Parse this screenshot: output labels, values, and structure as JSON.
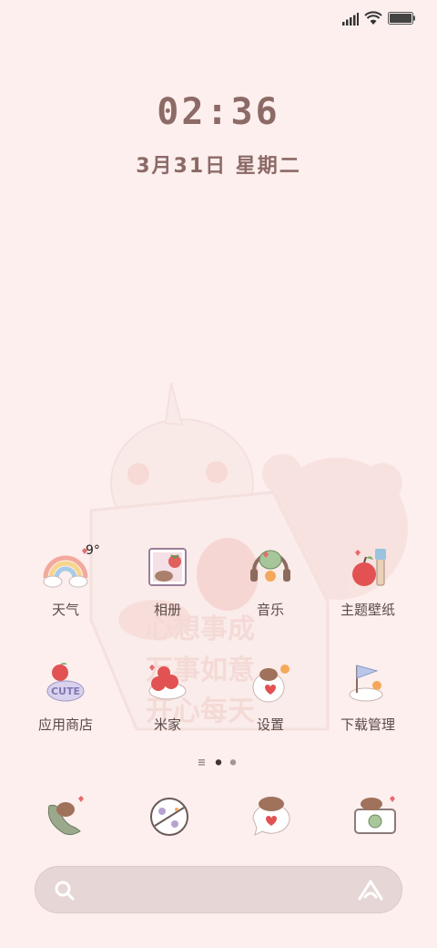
{
  "status_bar": {
    "signal_icon": "cellular-signal-icon",
    "wifi_icon": "wifi-icon",
    "battery_icon": "battery-icon"
  },
  "lock": {
    "time": "02:36",
    "date": "3月31日 星期二"
  },
  "weather_widget": {
    "temperature": "9°"
  },
  "apps": [
    {
      "label": "天气",
      "icon": "weather-rainbow-icon"
    },
    {
      "label": "相册",
      "icon": "gallery-icon"
    },
    {
      "label": "音乐",
      "icon": "music-icon"
    },
    {
      "label": "主题壁纸",
      "icon": "themes-icon"
    },
    {
      "label": "应用商店",
      "icon": "app-store-icon"
    },
    {
      "label": "米家",
      "icon": "mi-home-icon"
    },
    {
      "label": "设置",
      "icon": "settings-icon"
    },
    {
      "label": "下载管理",
      "icon": "download-manager-icon"
    }
  ],
  "pager": {
    "pages": 3,
    "current": 2
  },
  "dock": [
    {
      "icon": "phone-icon"
    },
    {
      "icon": "browser-icon"
    },
    {
      "icon": "messages-icon"
    },
    {
      "icon": "camera-icon"
    }
  ],
  "search": {
    "search_icon": "search-icon",
    "assistant_icon": "assistant-icon"
  },
  "colors": {
    "background": "#fcefee",
    "clock_text": "#8c6a66",
    "label_text": "#5b4a47",
    "search_bar": "#e6d7d6"
  }
}
